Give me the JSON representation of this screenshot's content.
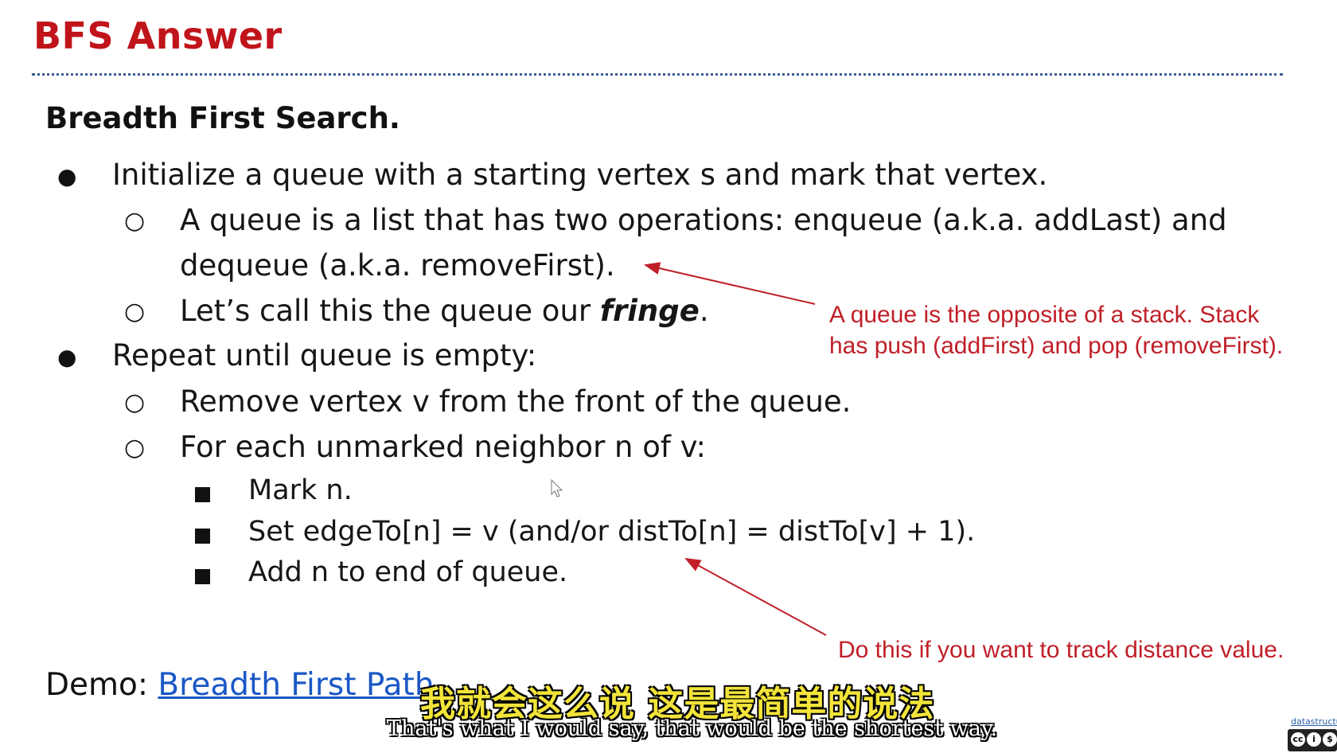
{
  "slide": {
    "title": "BFS Answer",
    "heading": "Breadth First Search.",
    "bullets": [
      {
        "bullet_glyph": "●",
        "text": "Initialize a queue with a starting vertex s and mark that vertex."
      },
      {
        "bullet_glyph": "○",
        "text_line1": "A queue is a list that has two operations: enqueue (a.k.a. addLast) and",
        "text_line2": "dequeue (a.k.a. removeFirst)."
      },
      {
        "bullet_glyph": "○",
        "text_pre": "Let’s call this the queue our ",
        "text_em": "fringe",
        "text_post": "."
      },
      {
        "bullet_glyph": "●",
        "text": "Repeat until queue is empty:"
      },
      {
        "bullet_glyph": "○",
        "text": "Remove vertex v from the front of the queue."
      },
      {
        "bullet_glyph": "○",
        "text": "For each unmarked neighbor n of v:"
      },
      {
        "text": "Mark n."
      },
      {
        "text": "Set edgeTo[n] = v (and/or distTo[n] = distTo[v] + 1)."
      },
      {
        "text": "Add n to end of queue."
      }
    ],
    "annotations": [
      {
        "line1": "A queue is the opposite of a stack. Stack",
        "line2": "has push (addFirst) and pop (removeFirst)."
      },
      {
        "line1": "Do this if you want to track distance value."
      }
    ],
    "demo_label": "Demo: ",
    "demo_link": "Breadth First Path"
  },
  "subtitles": {
    "zh": "我就会这么说 这是最简单的说法",
    "en": "That's what I would say, that would be the shortest way."
  },
  "license": {
    "site": "datastructur"
  },
  "colors": {
    "title": "#c0141b",
    "annotation": "#c01f28",
    "link": "#1a57c6",
    "subtitle_zh": "#f2e43a"
  }
}
